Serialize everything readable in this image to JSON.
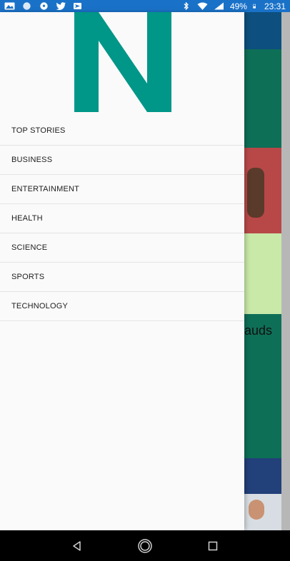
{
  "status_bar": {
    "battery_text": "49%",
    "time": "23:31",
    "left_icons": [
      "image-icon",
      "circle-app-icon",
      "soccer-ball-icon",
      "twitter-icon",
      "send-icon"
    ],
    "right_icons": [
      "bluetooth-icon",
      "wifi-icon",
      "signal-icon",
      "battery-icon"
    ]
  },
  "drawer": {
    "logo_letter": "N",
    "logo_color": "#009688",
    "menu_items": [
      {
        "label": "TOP STORIES"
      },
      {
        "label": "BUSINESS"
      },
      {
        "label": "ENTERTAINMENT"
      },
      {
        "label": "HEALTH"
      },
      {
        "label": "SCIENCE"
      },
      {
        "label": "SPORTS"
      },
      {
        "label": "TECHNOLOGY"
      }
    ]
  },
  "background": {
    "partial_headline": "auds"
  },
  "nav_bar": {
    "buttons": [
      "back-icon",
      "home-icon",
      "recents-icon"
    ]
  }
}
